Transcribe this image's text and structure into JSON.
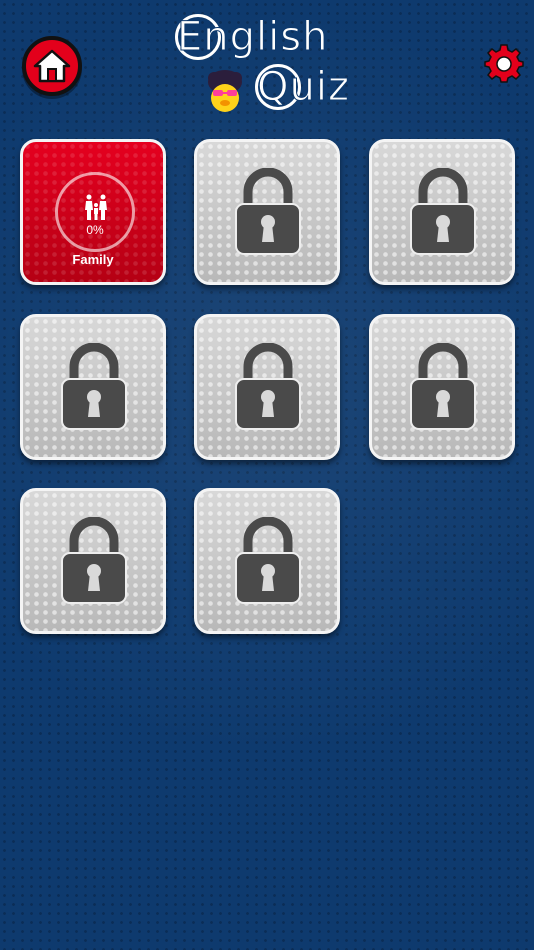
{
  "header": {
    "home_icon": "home-icon",
    "settings_icon": "gear-icon",
    "logo": {
      "line1": "English",
      "line2": "Quiz"
    }
  },
  "colors": {
    "background": "#0e3a6e",
    "accent_red": "#e3001b",
    "tile_locked": "#c9c9c9",
    "lock": "#4a4a4a"
  },
  "categories": [
    {
      "label": "Family",
      "progress": "0%",
      "locked": false,
      "icon": "family-icon"
    },
    {
      "label": "",
      "locked": true,
      "icon": "lock-icon"
    },
    {
      "label": "",
      "locked": true,
      "icon": "lock-icon"
    },
    {
      "label": "",
      "locked": true,
      "icon": "lock-icon"
    },
    {
      "label": "",
      "locked": true,
      "icon": "lock-icon"
    },
    {
      "label": "",
      "locked": true,
      "icon": "lock-icon"
    },
    {
      "label": "",
      "locked": true,
      "icon": "lock-icon"
    },
    {
      "label": "",
      "locked": true,
      "icon": "lock-icon"
    }
  ]
}
